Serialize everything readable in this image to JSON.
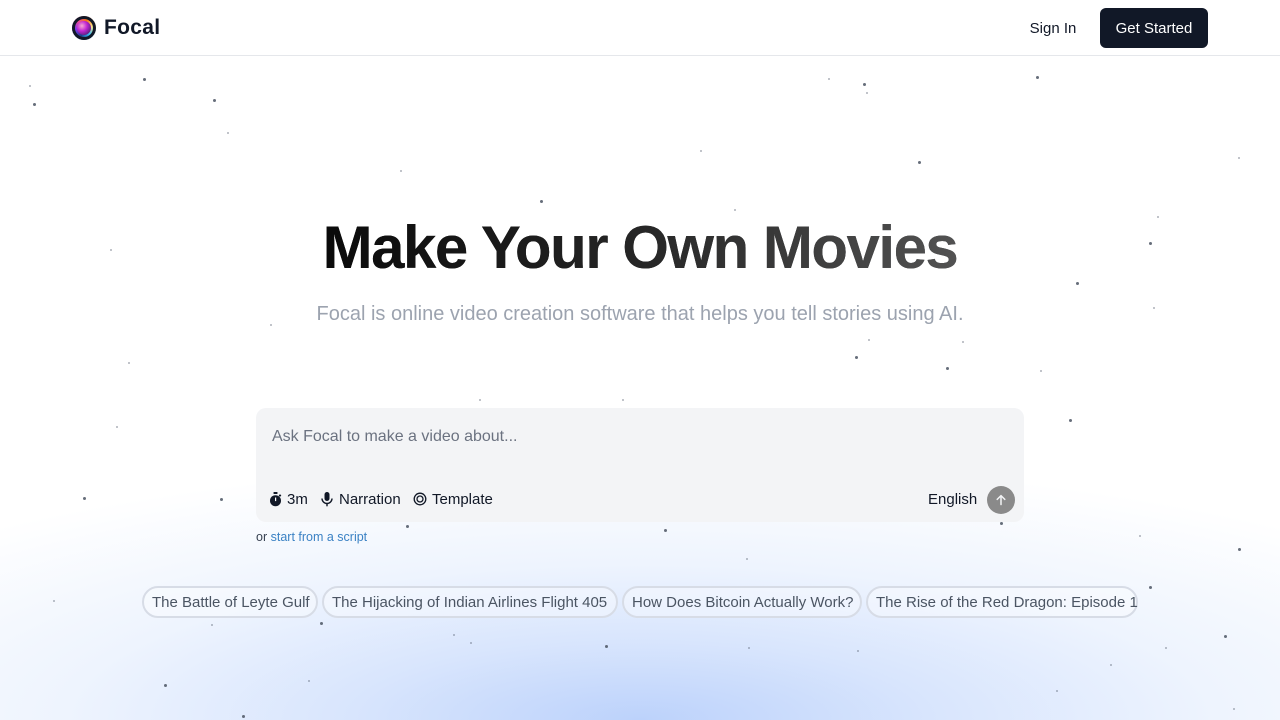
{
  "header": {
    "logo_text": "Focal",
    "sign_in_label": "Sign In",
    "get_started_label": "Get Started"
  },
  "hero": {
    "title": "Make Your Own Movies",
    "subtitle": "Focal is online video creation software that helps you tell stories using AI."
  },
  "prompt": {
    "placeholder": "Ask Focal to make a video about...",
    "value": "",
    "options": {
      "duration_label": "3m",
      "narration_label": "Narration",
      "template_label": "Template"
    },
    "language_label": "English"
  },
  "script_link": {
    "prefix": "or",
    "link_text": "start from a script"
  },
  "suggestions": [
    "The Battle of Leyte Gulf",
    "The Hijacking of Indian Airlines Flight 405",
    "How Does Bitcoin Actually Work?",
    "The Rise of the Red Dragon: Episode 1"
  ],
  "colors": {
    "primary_button": "#111827",
    "link": "#3b82c4",
    "send_button": "#8a8a8a",
    "glow": "#bcd2fb"
  },
  "icons": {
    "logo": "focal-logo-icon",
    "duration": "stopwatch-icon",
    "narration": "microphone-icon",
    "template": "template-circle-icon",
    "send": "arrow-up-icon"
  }
}
